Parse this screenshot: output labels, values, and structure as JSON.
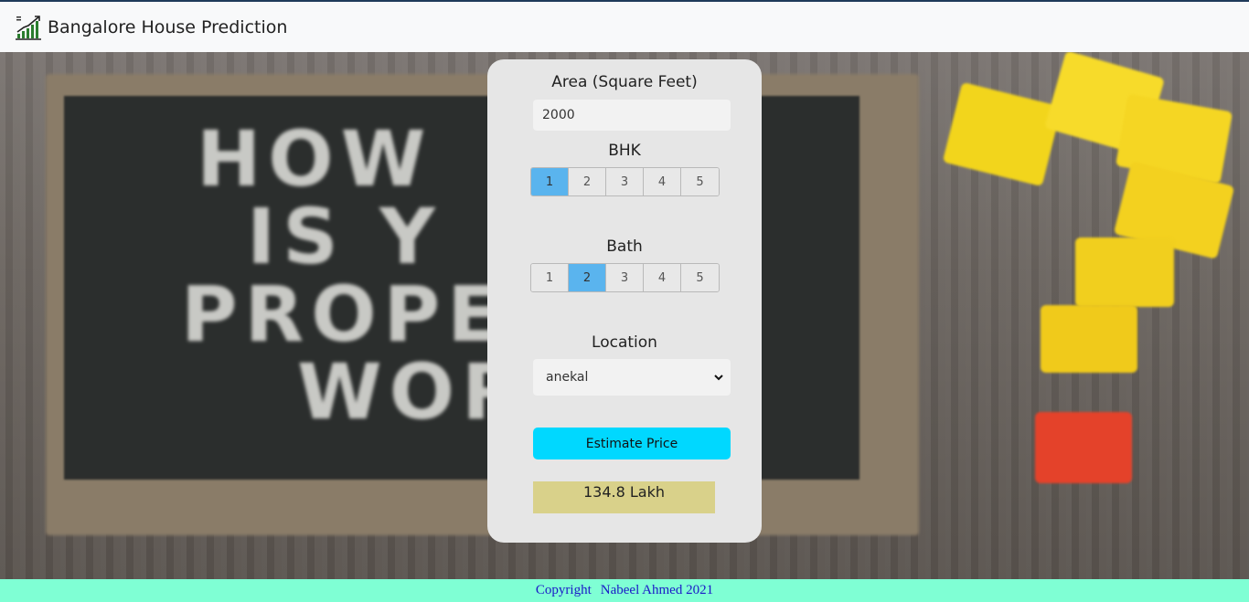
{
  "navbar": {
    "brand": "Bangalore House Prediction",
    "logo_icon": "chart-growth-icon"
  },
  "background": {
    "chalk_lines": [
      "HOW",
      "IS Y",
      "PROPE",
      "WOR"
    ]
  },
  "form": {
    "area_label": "Area (Square Feet)",
    "area_value": "2000",
    "bhk_label": "BHK",
    "bhk_options": [
      "1",
      "2",
      "3",
      "4",
      "5"
    ],
    "bhk_selected": "1",
    "bath_label": "Bath",
    "bath_options": [
      "1",
      "2",
      "3",
      "4",
      "5"
    ],
    "bath_selected": "2",
    "location_label": "Location",
    "location_value": "anekal",
    "estimate_label": "Estimate Price",
    "result": "134.8 Lakh"
  },
  "footer": {
    "copyright": "Copyright",
    "author": "Nabeel Ahmed 2021"
  },
  "colors": {
    "accent_selected": "#5ab4ee",
    "estimate_button": "#00d8ff",
    "result_bg": "#d9d18a",
    "footer_bg": "#7fffd4",
    "footer_text": "#1a18c8"
  }
}
